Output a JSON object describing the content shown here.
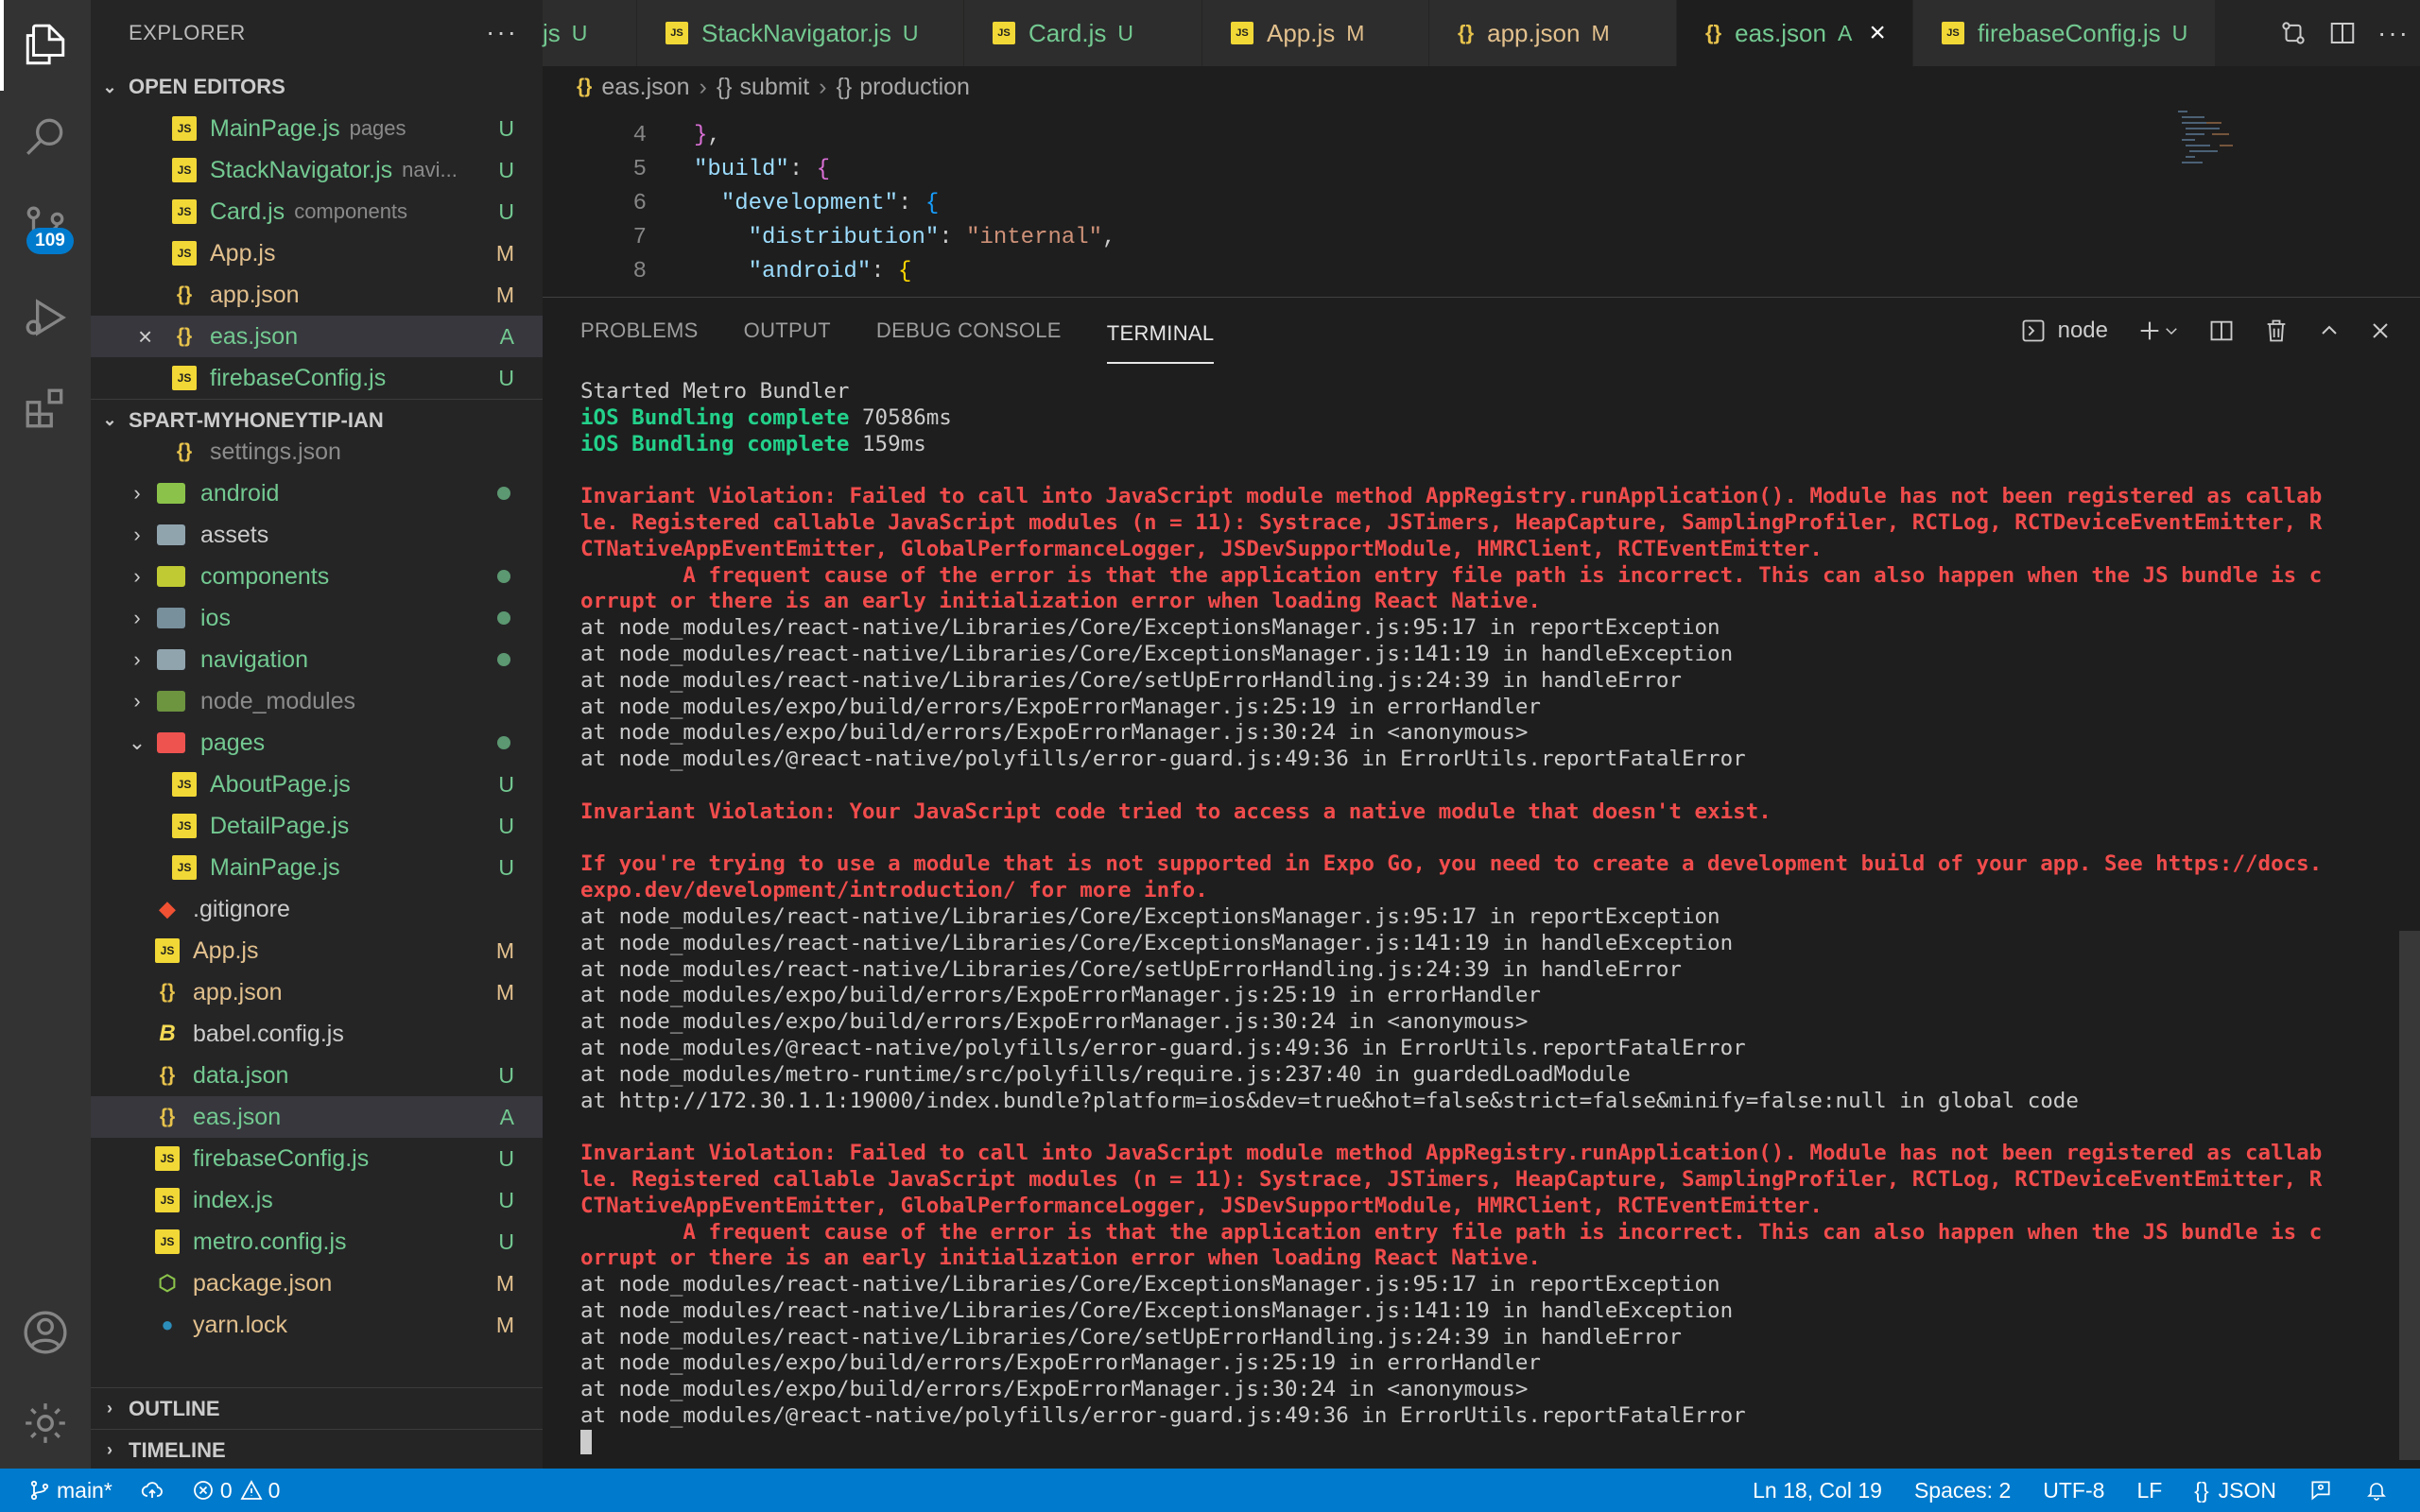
{
  "sidebar": {
    "title": "EXPLORER",
    "more": "···",
    "open_editors": {
      "title": "OPEN EDITORS",
      "items": [
        {
          "name": "MainPage.js",
          "desc": "pages",
          "status": "U"
        },
        {
          "name": "StackNavigator.js",
          "desc": "navi...",
          "status": "U"
        },
        {
          "name": "Card.js",
          "desc": "components",
          "status": "U"
        },
        {
          "name": "App.js",
          "desc": "",
          "status": "M"
        },
        {
          "name": "app.json",
          "desc": "",
          "status": "M"
        },
        {
          "name": "eas.json",
          "desc": "",
          "status": "A"
        },
        {
          "name": "firebaseConfig.js",
          "desc": "",
          "status": "U"
        }
      ]
    },
    "project": {
      "title": "SPART-MYHONEYTIP-IAN",
      "items": [
        {
          "name": "settings.json"
        },
        {
          "name": "android"
        },
        {
          "name": "assets"
        },
        {
          "name": "components"
        },
        {
          "name": "ios"
        },
        {
          "name": "navigation"
        },
        {
          "name": "node_modules"
        },
        {
          "name": "pages"
        },
        {
          "name": "AboutPage.js",
          "status": "U"
        },
        {
          "name": "DetailPage.js",
          "status": "U"
        },
        {
          "name": "MainPage.js",
          "status": "U"
        },
        {
          "name": ".gitignore"
        },
        {
          "name": "App.js",
          "status": "M"
        },
        {
          "name": "app.json",
          "status": "M"
        },
        {
          "name": "babel.config.js"
        },
        {
          "name": "data.json",
          "status": "U"
        },
        {
          "name": "eas.json",
          "status": "A"
        },
        {
          "name": "firebaseConfig.js",
          "status": "U"
        },
        {
          "name": "index.js",
          "status": "U"
        },
        {
          "name": "metro.config.js",
          "status": "U"
        },
        {
          "name": "package.json",
          "status": "M"
        },
        {
          "name": "yarn.lock",
          "status": "M"
        }
      ]
    },
    "outline": "OUTLINE",
    "timeline": "TIMELINE"
  },
  "activity": {
    "scm_badge": "109"
  },
  "tabs": [
    {
      "label": "js",
      "status": "U"
    },
    {
      "label": "StackNavigator.js",
      "status": "U"
    },
    {
      "label": "Card.js",
      "status": "U"
    },
    {
      "label": "App.js",
      "status": "M"
    },
    {
      "label": "app.json",
      "status": "M"
    },
    {
      "label": "eas.json",
      "status": "A"
    },
    {
      "label": "firebaseConfig.js",
      "status": "U"
    }
  ],
  "breadcrumb": [
    "eas.json",
    "submit",
    "production"
  ],
  "editor": {
    "line_numbers": [
      "4",
      "5",
      "6",
      "7",
      "8"
    ]
  },
  "panel": {
    "tabs": [
      "PROBLEMS",
      "OUTPUT",
      "DEBUG CONSOLE",
      "TERMINAL"
    ],
    "shell": "node",
    "terminal_lines": [
      {
        "t": "w",
        "v": "Started Metro Bundler"
      },
      {
        "t": "g",
        "v": "iOS Bundling complete 70586ms",
        "p": "iOS Bundling complete ",
        "q": "70586ms"
      },
      {
        "t": "g",
        "v": "iOS Bundling complete 159ms",
        "p": "iOS Bundling complete ",
        "q": "159ms"
      },
      {
        "t": "e",
        "v": ""
      },
      {
        "t": "r",
        "v": "Invariant Violation: Failed to call into JavaScript module method AppRegistry.runApplication(). Module has not been registered as callab"
      },
      {
        "t": "r",
        "v": "le. Registered callable JavaScript modules (n = 11): Systrace, JSTimers, HeapCapture, SamplingProfiler, RCTLog, RCTDeviceEventEmitter, R"
      },
      {
        "t": "r",
        "v": "CTNativeAppEventEmitter, GlobalPerformanceLogger, JSDevSupportModule, HMRClient, RCTEventEmitter."
      },
      {
        "t": "r",
        "v": "        A frequent cause of the error is that the application entry file path is incorrect. This can also happen when the JS bundle is c"
      },
      {
        "t": "r",
        "v": "orrupt or there is an early initialization error when loading React Native."
      },
      {
        "t": "w",
        "v": "at node_modules/react-native/Libraries/Core/ExceptionsManager.js:95:17 in reportException"
      },
      {
        "t": "w",
        "v": "at node_modules/react-native/Libraries/Core/ExceptionsManager.js:141:19 in handleException"
      },
      {
        "t": "w",
        "v": "at node_modules/react-native/Libraries/Core/setUpErrorHandling.js:24:39 in handleError"
      },
      {
        "t": "w",
        "v": "at node_modules/expo/build/errors/ExpoErrorManager.js:25:19 in errorHandler"
      },
      {
        "t": "w",
        "v": "at node_modules/expo/build/errors/ExpoErrorManager.js:30:24 in <anonymous>"
      },
      {
        "t": "w",
        "v": "at node_modules/@react-native/polyfills/error-guard.js:49:36 in ErrorUtils.reportFatalError"
      },
      {
        "t": "e",
        "v": ""
      },
      {
        "t": "r",
        "v": "Invariant Violation: Your JavaScript code tried to access a native module that doesn't exist."
      },
      {
        "t": "e",
        "v": ""
      },
      {
        "t": "r",
        "v": "If you're trying to use a module that is not supported in Expo Go, you need to create a development build of your app. See https://docs."
      },
      {
        "t": "r",
        "v": "expo.dev/development/introduction/ for more info."
      },
      {
        "t": "w",
        "v": "at node_modules/react-native/Libraries/Core/ExceptionsManager.js:95:17 in reportException"
      },
      {
        "t": "w",
        "v": "at node_modules/react-native/Libraries/Core/ExceptionsManager.js:141:19 in handleException"
      },
      {
        "t": "w",
        "v": "at node_modules/react-native/Libraries/Core/setUpErrorHandling.js:24:39 in handleError"
      },
      {
        "t": "w",
        "v": "at node_modules/expo/build/errors/ExpoErrorManager.js:25:19 in errorHandler"
      },
      {
        "t": "w",
        "v": "at node_modules/expo/build/errors/ExpoErrorManager.js:30:24 in <anonymous>"
      },
      {
        "t": "w",
        "v": "at node_modules/@react-native/polyfills/error-guard.js:49:36 in ErrorUtils.reportFatalError"
      },
      {
        "t": "w",
        "v": "at node_modules/metro-runtime/src/polyfills/require.js:237:40 in guardedLoadModule"
      },
      {
        "t": "w",
        "v": "at http://172.30.1.1:19000/index.bundle?platform=ios&dev=true&hot=false&strict=false&minify=false:null in global code"
      },
      {
        "t": "e",
        "v": ""
      },
      {
        "t": "r",
        "v": "Invariant Violation: Failed to call into JavaScript module method AppRegistry.runApplication(). Module has not been registered as callab"
      },
      {
        "t": "r",
        "v": "le. Registered callable JavaScript modules (n = 11): Systrace, JSTimers, HeapCapture, SamplingProfiler, RCTLog, RCTDeviceEventEmitter, R"
      },
      {
        "t": "r",
        "v": "CTNativeAppEventEmitter, GlobalPerformanceLogger, JSDevSupportModule, HMRClient, RCTEventEmitter."
      },
      {
        "t": "r",
        "v": "        A frequent cause of the error is that the application entry file path is incorrect. This can also happen when the JS bundle is c"
      },
      {
        "t": "r",
        "v": "orrupt or there is an early initialization error when loading React Native."
      },
      {
        "t": "w",
        "v": "at node_modules/react-native/Libraries/Core/ExceptionsManager.js:95:17 in reportException"
      },
      {
        "t": "w",
        "v": "at node_modules/react-native/Libraries/Core/ExceptionsManager.js:141:19 in handleException"
      },
      {
        "t": "w",
        "v": "at node_modules/react-native/Libraries/Core/setUpErrorHandling.js:24:39 in handleError"
      },
      {
        "t": "w",
        "v": "at node_modules/expo/build/errors/ExpoErrorManager.js:25:19 in errorHandler"
      },
      {
        "t": "w",
        "v": "at node_modules/expo/build/errors/ExpoErrorManager.js:30:24 in <anonymous>"
      },
      {
        "t": "w",
        "v": "at node_modules/@react-native/polyfills/error-guard.js:49:36 in ErrorUtils.reportFatalError"
      }
    ]
  },
  "status": {
    "branch": "main*",
    "errors": "0",
    "warnings": "0",
    "position": "Ln 18, Col 19",
    "spaces": "Spaces: 2",
    "encoding": "UTF-8",
    "eol": "LF",
    "language": "JSON"
  },
  "colors": {
    "accent": "#007acc",
    "untracked": "#73c991",
    "modified": "#e2c08d",
    "error": "#f14c4c",
    "success": "#23d18b"
  }
}
